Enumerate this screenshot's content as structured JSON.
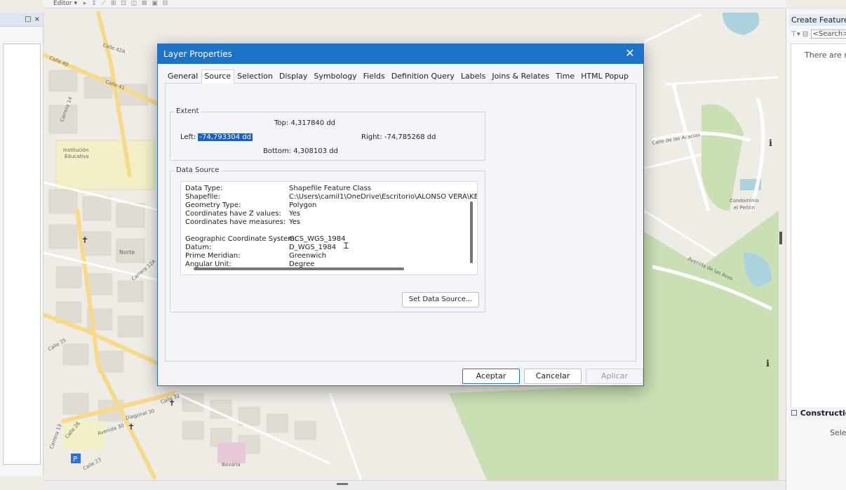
{
  "toolbar": {
    "editor_label": "Editor ▾",
    "glyphs": "▸ ↕ ⟋ ⊞ ⊡ ◫ ⊠ ▣ ⊟"
  },
  "left_panel": {
    "pin_glyph": "□",
    "close_glyph": "×"
  },
  "right_panel": {
    "title": "Create Features",
    "search_placeholder": "<Search>",
    "empty_text": "There are no",
    "construction_title": "Construction",
    "select_text": "Select"
  },
  "map_labels": [
    "Calle 40",
    "Calle 42A",
    "Calle 41",
    "Carrera 14",
    "Institución Educativa",
    "Norte",
    "Calle 35",
    "Carrera 12A",
    "Calle 32",
    "Diagonal 30",
    "Avenida 30",
    "Calle 26",
    "Carrera 13",
    "Calle 23",
    "Bavaria",
    "Condominio el Peñón",
    "Avenida de las Aves",
    "Calle de las Acacias"
  ],
  "dialog": {
    "title": "Layer Properties",
    "close_glyph": "✕",
    "tabs": [
      "General",
      "Source",
      "Selection",
      "Display",
      "Symbology",
      "Fields",
      "Definition Query",
      "Labels",
      "Joins & Relates",
      "Time",
      "HTML Popup"
    ],
    "active_tab": "Source",
    "extent": {
      "label": "Extent",
      "top_label": "Top:",
      "top_value": "4,317840 dd",
      "left_label": "Left:",
      "left_value": "-74,793304 dd",
      "right_label": "Right:",
      "right_value": "-74,785268 dd",
      "bottom_label": "Bottom:",
      "bottom_value": "4,308103 dd"
    },
    "data_source": {
      "label": "Data Source",
      "rows": [
        {
          "key": "Data Type:",
          "value": "Shapefile Feature Class"
        },
        {
          "key": "Shapefile:",
          "value": "C:\\Users\\camil1\\OneDrive\\Escritorio\\ALONSO VERA\\KE"
        },
        {
          "key": "Geometry Type:",
          "value": "Polygon"
        },
        {
          "key": "Coordinates have Z values:",
          "value": "Yes"
        },
        {
          "key": "Coordinates have measures:",
          "value": "Yes"
        },
        {
          "key": "Geographic Coordinate System:",
          "value": "GCS_WGS_1984"
        },
        {
          "key": "Datum:",
          "value": "D_WGS_1984"
        },
        {
          "key": "Prime Meridian:",
          "value": "Greenwich"
        },
        {
          "key": "Angular Unit:",
          "value": "Degree"
        }
      ],
      "set_button": "Set Data Source..."
    },
    "buttons": {
      "ok": "Aceptar",
      "cancel": "Cancelar",
      "apply": "Aplicar"
    }
  },
  "colors": {
    "title_bar": "#1c73c7",
    "selection": "#1f5fbf",
    "park": "#c7dfb0",
    "road": "#f7d98a"
  }
}
